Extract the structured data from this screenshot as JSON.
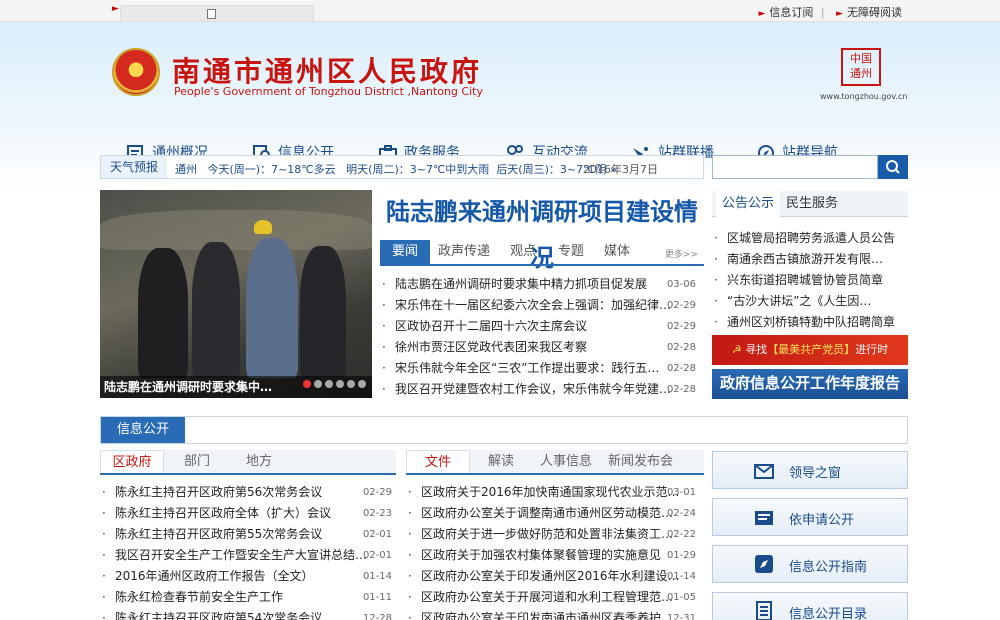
{
  "topbar": {
    "links": [
      "信息订阅",
      "无障碍阅读"
    ]
  },
  "header": {
    "title": "南通市通州区人民政府",
    "subtitle": "People's Government of Tongzhou District ,Nantong City",
    "seal_text": "中国通州",
    "seal_url": "www.tongzhou.gov.cn"
  },
  "nav": [
    {
      "label": "通州概况",
      "icon": "book-icon"
    },
    {
      "label": "信息公开",
      "icon": "search-doc-icon"
    },
    {
      "label": "政务服务",
      "icon": "briefcase-icon"
    },
    {
      "label": "互动交流",
      "icon": "people-icon"
    },
    {
      "label": "站群联播",
      "icon": "satellite-icon"
    },
    {
      "label": "站群导航",
      "icon": "compass-icon"
    }
  ],
  "weather": {
    "label": "天气预报",
    "city": "通州",
    "today": "今天(周一)：7~18℃多云",
    "tomorrow": "明天(周二)：3~7℃中到大雨",
    "after": "后天(周三)：3~7℃阴",
    "date": "2016年3月7日"
  },
  "photo": {
    "caption": "陆志鹏在通州调研时要求集中…"
  },
  "headline": "陆志鹏来通州调研项目建设情况",
  "news_tabs": [
    "要闻",
    "政声传递",
    "观点",
    "专题",
    "媒体"
  ],
  "news_more": "更多>>",
  "news": [
    {
      "title": "陆志鹏在通州调研时要求集中精力抓项目促发展",
      "date": "03-06"
    },
    {
      "title": "宋乐伟在十一届区纪委六次全会上强调：加强纪律…",
      "date": "02-29"
    },
    {
      "title": "区政协召开十二届四十六次主席会议",
      "date": "02-29"
    },
    {
      "title": "徐州市贾汪区党政代表团来我区考察",
      "date": "02-28"
    },
    {
      "title": "宋乐伟就今年全区“三农”工作提出要求：践行五…",
      "date": "02-28"
    },
    {
      "title": "我区召开党建暨农村工作会议，宋乐伟就今年党建…",
      "date": "02-28"
    }
  ],
  "notice_tabs": [
    "公告公示",
    "民生服务"
  ],
  "notices": [
    "区城管局招聘劳务派遣人员公告",
    "南通余西古镇旅游开发有限…",
    "兴东街道招聘城管协管员简章",
    "“古沙大讲坛”之《人生因…",
    "通州区刘桥镇特勤中队招聘简章"
  ],
  "banner1": {
    "pre": "寻找",
    "highlight": "【最美共产党员】",
    "post": "进行时"
  },
  "banner2": "政府信息公开工作年度报告",
  "section_title": "信息公开",
  "left_tabs": [
    "区政府",
    "部门",
    "地方"
  ],
  "left_list": [
    {
      "title": "陈永红主持召开区政府第56次常务会议",
      "date": "02-29"
    },
    {
      "title": "陈永红主持召开区政府全体（扩大）会议",
      "date": "02-23"
    },
    {
      "title": "陈永红主持召开区政府第55次常务会议",
      "date": "02-01"
    },
    {
      "title": "我区召开安全生产工作暨安全生产大宣讲总结…",
      "date": "02-01"
    },
    {
      "title": "2016年通州区政府工作报告（全文）",
      "date": "01-14"
    },
    {
      "title": "陈永红检查春节前安全生产工作",
      "date": "01-11"
    },
    {
      "title": "陈永红主持召开区政府第54次常务会议",
      "date": "12-28"
    }
  ],
  "mid_tabs": [
    "文件",
    "解读",
    "人事信息",
    "新闻发布会"
  ],
  "mid_list": [
    {
      "title": "区政府关于2016年加快南通国家现代农业示范…",
      "date": "03-01"
    },
    {
      "title": "区政府办公室关于调整南通市通州区劳动模范…",
      "date": "02-24"
    },
    {
      "title": "区政府关于进一步做好防范和处置非法集资工…",
      "date": "02-22"
    },
    {
      "title": "区政府关于加强农村集体聚餐管理的实施意见",
      "date": "01-29"
    },
    {
      "title": "区政府办公室关于印发通州区2016年水利建设…",
      "date": "01-14"
    },
    {
      "title": "区政府办公室关于开展河道和水利工程管理范…",
      "date": "01-05"
    },
    {
      "title": "区政府办公室关于印发南通市通州区春季养护…",
      "date": "12-31"
    }
  ],
  "side_buttons": [
    {
      "label": "领导之窗",
      "icon": "mail-icon"
    },
    {
      "label": "依申请公开",
      "icon": "folder-icon"
    },
    {
      "label": "信息公开指南",
      "icon": "compass-icon"
    },
    {
      "label": "信息公开目录",
      "icon": "list-icon"
    }
  ],
  "colors": {
    "brand_red": "#c8140f",
    "brand_blue": "#2a6bb5"
  }
}
